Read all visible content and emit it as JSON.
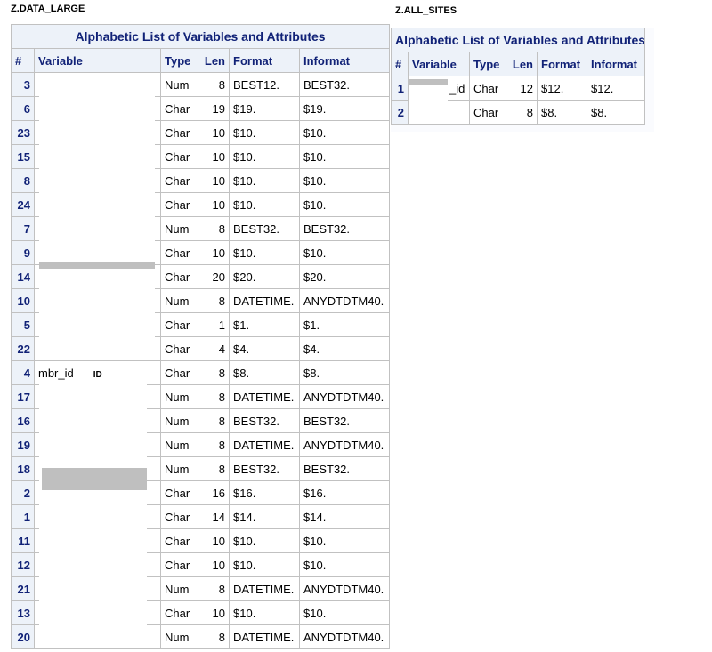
{
  "tables": [
    {
      "dataset": "Z.DATA_LARGE",
      "title": "Alphabetic List of Variables and Attributes",
      "columns": [
        "#",
        "Variable",
        "Type",
        "Len",
        "Format",
        "Informat"
      ],
      "rows": [
        [
          "3",
          "",
          "Num",
          "8",
          "BEST12.",
          "BEST32.",
          ""
        ],
        [
          "6",
          "",
          "Char",
          "19",
          "$19.",
          "$19.",
          ""
        ],
        [
          "23",
          "",
          "Char",
          "10",
          "$10.",
          "$10.",
          ""
        ],
        [
          "15",
          "",
          "Char",
          "10",
          "$10.",
          "$10.",
          ""
        ],
        [
          "8",
          "",
          "Char",
          "10",
          "$10.",
          "$10.",
          ""
        ],
        [
          "24",
          "",
          "Char",
          "10",
          "$10.",
          "$10.",
          ""
        ],
        [
          "7",
          "",
          "Num",
          "8",
          "BEST32.",
          "BEST32.",
          ""
        ],
        [
          "9",
          "",
          "Char",
          "10",
          "$10.",
          "$10.",
          ""
        ],
        [
          "14",
          "",
          "Char",
          "20",
          "$20.",
          "$20.",
          ""
        ],
        [
          "10",
          "",
          "Num",
          "8",
          "DATETIME.",
          "ANYDTDTM40.",
          ""
        ],
        [
          "5",
          "",
          "Char",
          "1",
          "$1.",
          "$1.",
          ""
        ],
        [
          "22",
          "",
          "Char",
          "4",
          "$4.",
          "$4.",
          ""
        ],
        [
          "4",
          "mbr_id",
          "Char",
          "8",
          "$8.",
          "$8.",
          "ID"
        ],
        [
          "17",
          "",
          "Num",
          "8",
          "DATETIME.",
          "ANYDTDTM40.",
          ""
        ],
        [
          "16",
          "",
          "Num",
          "8",
          "BEST32.",
          "BEST32.",
          ""
        ],
        [
          "19",
          "",
          "Num",
          "8",
          "DATETIME.",
          "ANYDTDTM40.",
          ""
        ],
        [
          "18",
          "",
          "Num",
          "8",
          "BEST32.",
          "BEST32.",
          ""
        ],
        [
          "2",
          "",
          "Char",
          "16",
          "$16.",
          "$16.",
          ""
        ],
        [
          "1",
          "",
          "Char",
          "14",
          "$14.",
          "$14.",
          ""
        ],
        [
          "11",
          "",
          "Char",
          "10",
          "$10.",
          "$10.",
          ""
        ],
        [
          "12",
          "",
          "Char",
          "10",
          "$10.",
          "$10.",
          ""
        ],
        [
          "21",
          "",
          "Num",
          "8",
          "DATETIME.",
          "ANYDTDTM40.",
          ""
        ],
        [
          "13",
          "",
          "Char",
          "10",
          "$10.",
          "$10.",
          ""
        ],
        [
          "20",
          "",
          "Num",
          "8",
          "DATETIME.",
          "ANYDTDTM40.",
          ""
        ]
      ]
    },
    {
      "dataset": "Z.ALL_SITES",
      "title": "Alphabetic List of Variables and Attributes",
      "columns": [
        "#",
        "Variable",
        "Type",
        "Len",
        "Format",
        "Informat"
      ],
      "rows": [
        [
          "1",
          "_id",
          "Char",
          "12",
          "$12.",
          "$12.",
          ""
        ],
        [
          "2",
          "",
          "Char",
          "8",
          "$8.",
          "$8.",
          ""
        ]
      ]
    }
  ]
}
